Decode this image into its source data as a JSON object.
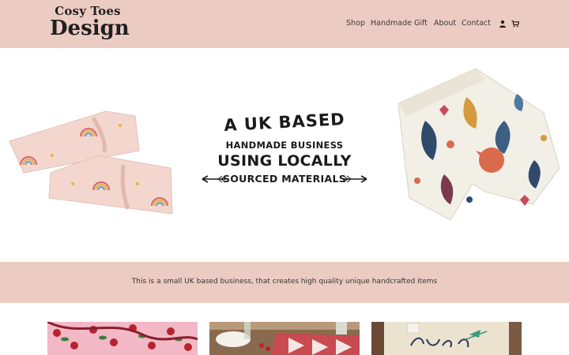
{
  "header": {
    "logo_top": "Cosy Toes",
    "logo_bottom": "Design",
    "nav": [
      "Shop",
      "Handmade",
      "Gift",
      "About",
      "Contact"
    ],
    "icons": [
      "user-icon",
      "cart-icon"
    ]
  },
  "hero": {
    "tagline": {
      "line1": "A UK BASED",
      "line2": "HANDMADE BUSINESS",
      "line3": "USING LOCALLY",
      "line4": "SOURCED MATERIALS"
    },
    "images": [
      "headbands-photo",
      "baby-shorts-photo"
    ]
  },
  "band": {
    "text": "This is a small UK based business, that creates high quality unique handcrafted items"
  },
  "products": [
    "cherry-print-fabric-photo",
    "table-runner-photo",
    "embroidered-tote-photo"
  ],
  "colors": {
    "header_bg": "#ecccc2",
    "band_bg": "#ecccc2",
    "text": "#2b2b2b"
  }
}
